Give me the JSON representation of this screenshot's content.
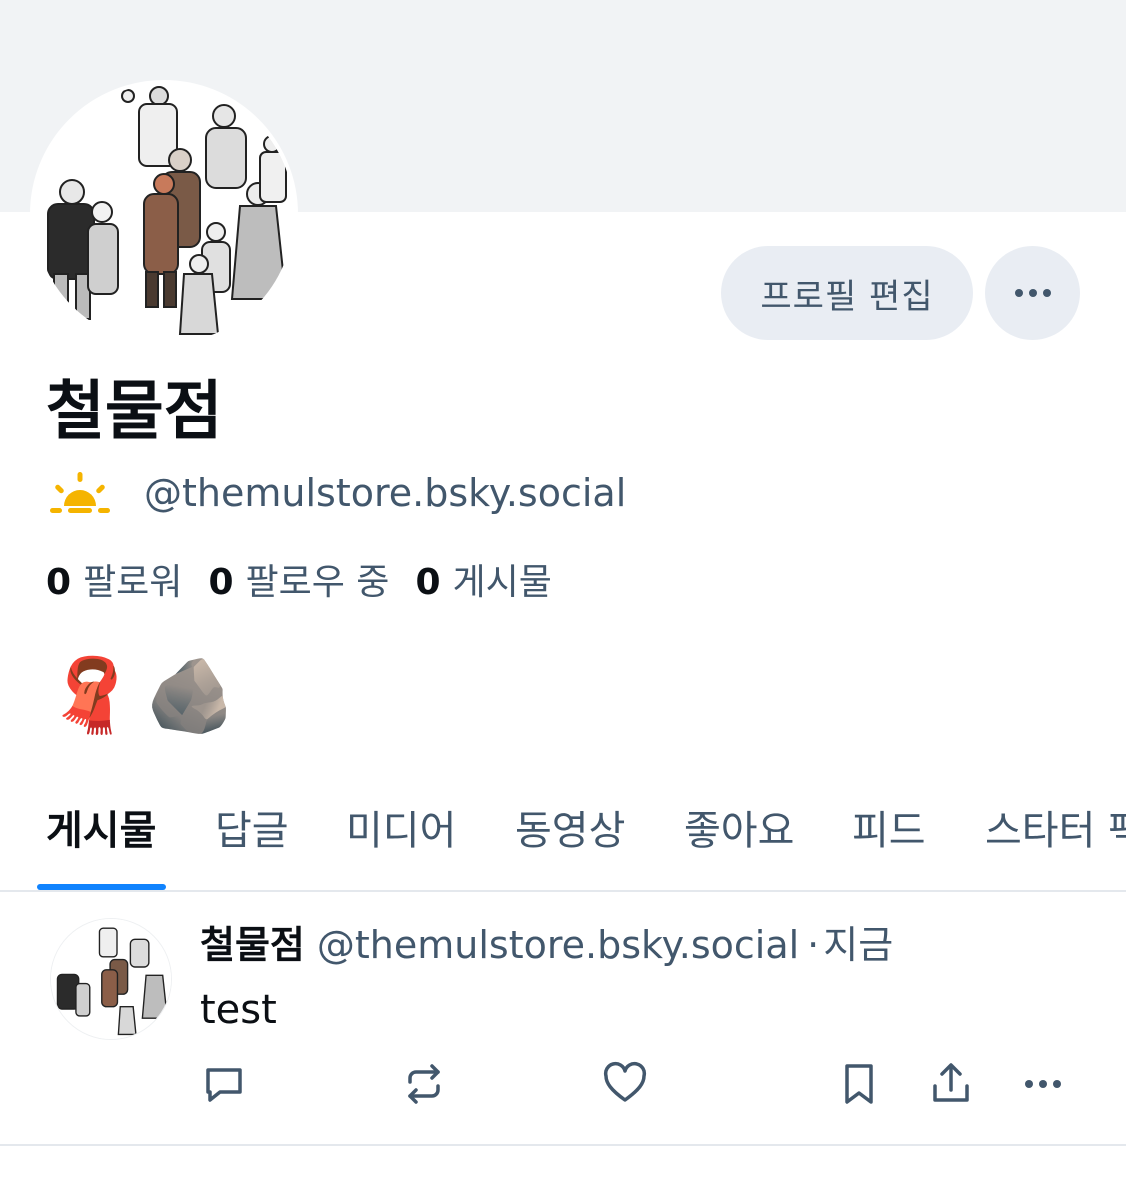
{
  "profile": {
    "display_name": "철물점",
    "handle": "@themulstore.bsky.social",
    "edit_button_label": "프로필 편집",
    "more_button_icon": "ellipsis-icon",
    "status_icon": "sunrise-icon",
    "colors": {
      "accent": "#1083fe",
      "muted_text": "#42576c",
      "button_bg": "#e9edf3",
      "banner_bg": "#f1f3f5"
    }
  },
  "stats": {
    "followers": {
      "count": "0",
      "label": "팔로워"
    },
    "following": {
      "count": "0",
      "label": "팔로우 중"
    },
    "posts": {
      "count": "0",
      "label": "게시물"
    }
  },
  "bio": {
    "emojis": [
      "🧣",
      "🪨"
    ]
  },
  "tabs": [
    {
      "label": "게시물",
      "active": true
    },
    {
      "label": "답글"
    },
    {
      "label": "미디어"
    },
    {
      "label": "동영상"
    },
    {
      "label": "좋아요"
    },
    {
      "label": "피드"
    },
    {
      "label": "스타터 팩"
    }
  ],
  "feed": [
    {
      "author_name": "철물점",
      "author_handle": "@themulstore.bsky.social",
      "separator": "·",
      "time": "지금",
      "text": "test",
      "actions": [
        "reply-icon",
        "repost-icon",
        "like-icon",
        "bookmark-icon",
        "share-icon",
        "more-icon"
      ]
    }
  ]
}
